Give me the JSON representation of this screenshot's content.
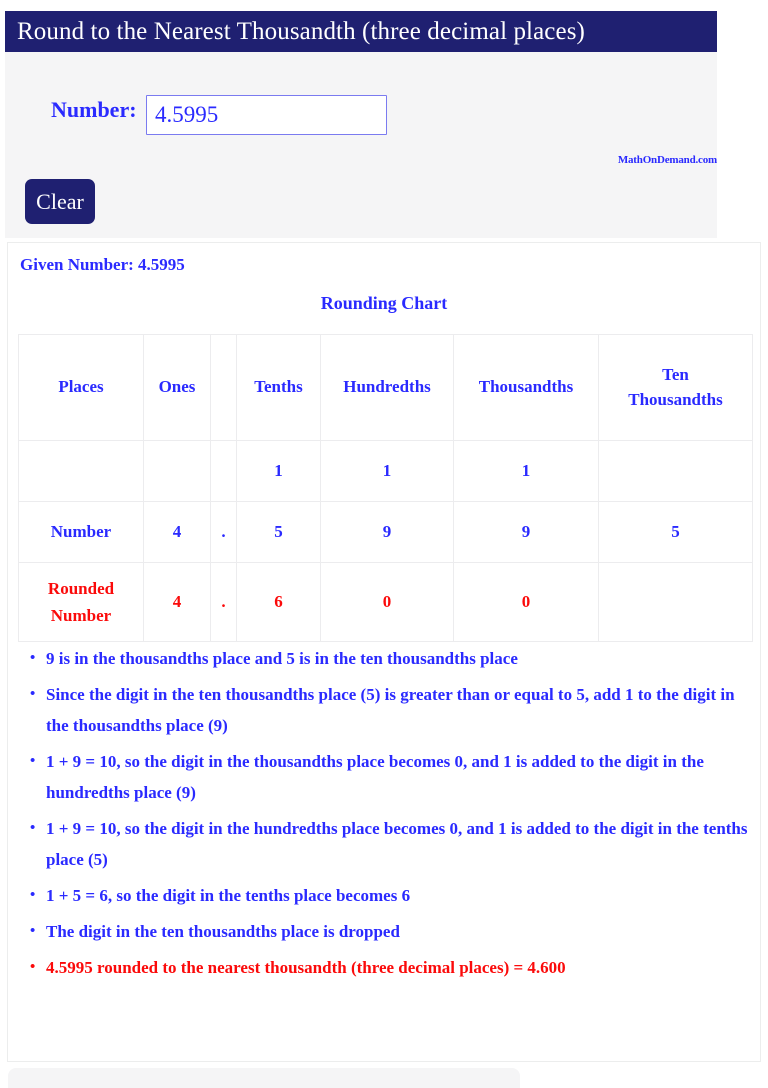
{
  "header": {
    "title": "Round to the Nearest Thousandth (three decimal places)"
  },
  "form": {
    "number_label": "Number:",
    "number_value": "4.5995",
    "number_placeholder": "",
    "clear_label": "Clear",
    "brand": "MathOnDemand.com"
  },
  "result": {
    "given_number_line": "Given Number: 4.5995",
    "chart_title": "Rounding Chart"
  },
  "table": {
    "headers": {
      "places": "Places",
      "ones": "Ones",
      "dot": "",
      "tenths": "Tenths",
      "hundredths": "Hundredths",
      "thousandths": "Thousandths",
      "ten_thousandths_line1": "Ten",
      "ten_thousandths_line2": "Thousandths"
    },
    "carry_row": {
      "places": "",
      "ones": "",
      "dot": "",
      "tenths": "1",
      "hundredths": "1",
      "thousandths": "1",
      "ten_thousandths": ""
    },
    "number_row": {
      "label": "Number",
      "ones": "4",
      "dot": ".",
      "tenths": "5",
      "hundredths": "9",
      "thousandths": "9",
      "ten_thousandths": "5"
    },
    "rounded_row": {
      "label_line1": "Rounded",
      "label_line2": "Number",
      "ones": "4",
      "dot": ".",
      "tenths": "6",
      "hundredths": "0",
      "thousandths": "0",
      "ten_thousandths": ""
    }
  },
  "explanation": [
    "9 is in the thousandths place and 5 is in the ten thousandths place",
    "Since the digit in the ten thousandths place (5) is greater than or equal to 5, add 1 to the digit in the thousandths place (9)",
    "1 + 9 = 10, so the digit in the thousandths place becomes 0, and 1 is added to the digit in the hundredths place (9)",
    "1 + 9 = 10, so the digit in the hundredths place becomes 0, and 1 is added to the digit in the tenths place (5)",
    "1 + 5 = 6, so the digit in the tenths place becomes 6",
    "The digit in the ten thousandths place is dropped",
    "4.5995 rounded to the nearest thousandth (three decimal places) = 4.600"
  ],
  "colors": {
    "navy": "#1f2071",
    "blue_text": "#2a2aff",
    "red_text": "#fb0a0a",
    "panel_bg": "#f5f5f6",
    "border": "#ececee"
  }
}
